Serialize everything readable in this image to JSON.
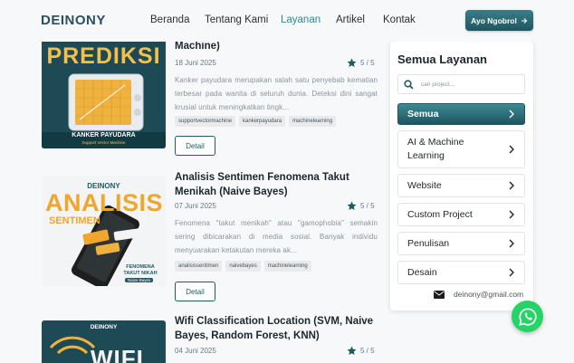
{
  "nav": {
    "brand": "DEINONY",
    "links": [
      "Beranda",
      "Tentang Kami",
      "Layanan",
      "Artikel",
      "Kontak"
    ],
    "cta_label": "Ayo Ngobrol",
    "cta_icon": "arrow-right-icon"
  },
  "cards": [
    {
      "image_text": "PREDIKSI",
      "image_caption": "KANKER PAYUDARA",
      "image_subcaption": "Support Vector Machine",
      "title": "Machine)",
      "date": "18 Juni 2025",
      "rating": "5 / 5",
      "description": "Kanker payudara merupakan salah satu penyebab kematian terbesar pada wanita di seluruh dunia. Deteksi dini sangat krusial untuk meningkatkan tingk...",
      "tags": [
        "supportvectormachine",
        "kankerpayudara",
        "machinelearning"
      ],
      "button": "Detail"
    },
    {
      "image_text": "ANALISIS",
      "image_text2": "SENTIMEN",
      "image_caption": "FENOMENA TAKUT NIKAH",
      "image_subcaption": "Naive Bayes",
      "title": "Analisis Sentimen Fenomena Takut Menikah (Naive Bayes)",
      "date": "07 Juni 2025",
      "rating": "5 / 5",
      "description": "Fenomena \"takut menikah\" atau \"gamophobia\" semakin sering dibicarakan di media sosial. Banyak individu menyuarakan ketakutan mereka ak...",
      "tags": [
        "analisissentimen",
        "naivebayes",
        "machinelearning"
      ],
      "button": "Detail"
    },
    {
      "image_text": "WIFI",
      "title": "Wifi Classification Location (SVM, Naive Bayes, Random Forest, KNN)",
      "date": "04 Juni 2025",
      "rating": "5 / 5"
    }
  ],
  "image_logo": "DEINONY",
  "sidebar": {
    "title": "Semua Layanan",
    "search_placeholder": "cari project...",
    "items": [
      "Semua",
      "AI & Machine Learning",
      "Website",
      "Custom Project",
      "Penulisan",
      "Desain"
    ],
    "email": "deinony@gmail.com"
  },
  "colors": {
    "brand": "#27525b",
    "accent": "#2a8b93",
    "star": "#1e5b66",
    "whatsapp": "#25d366"
  }
}
